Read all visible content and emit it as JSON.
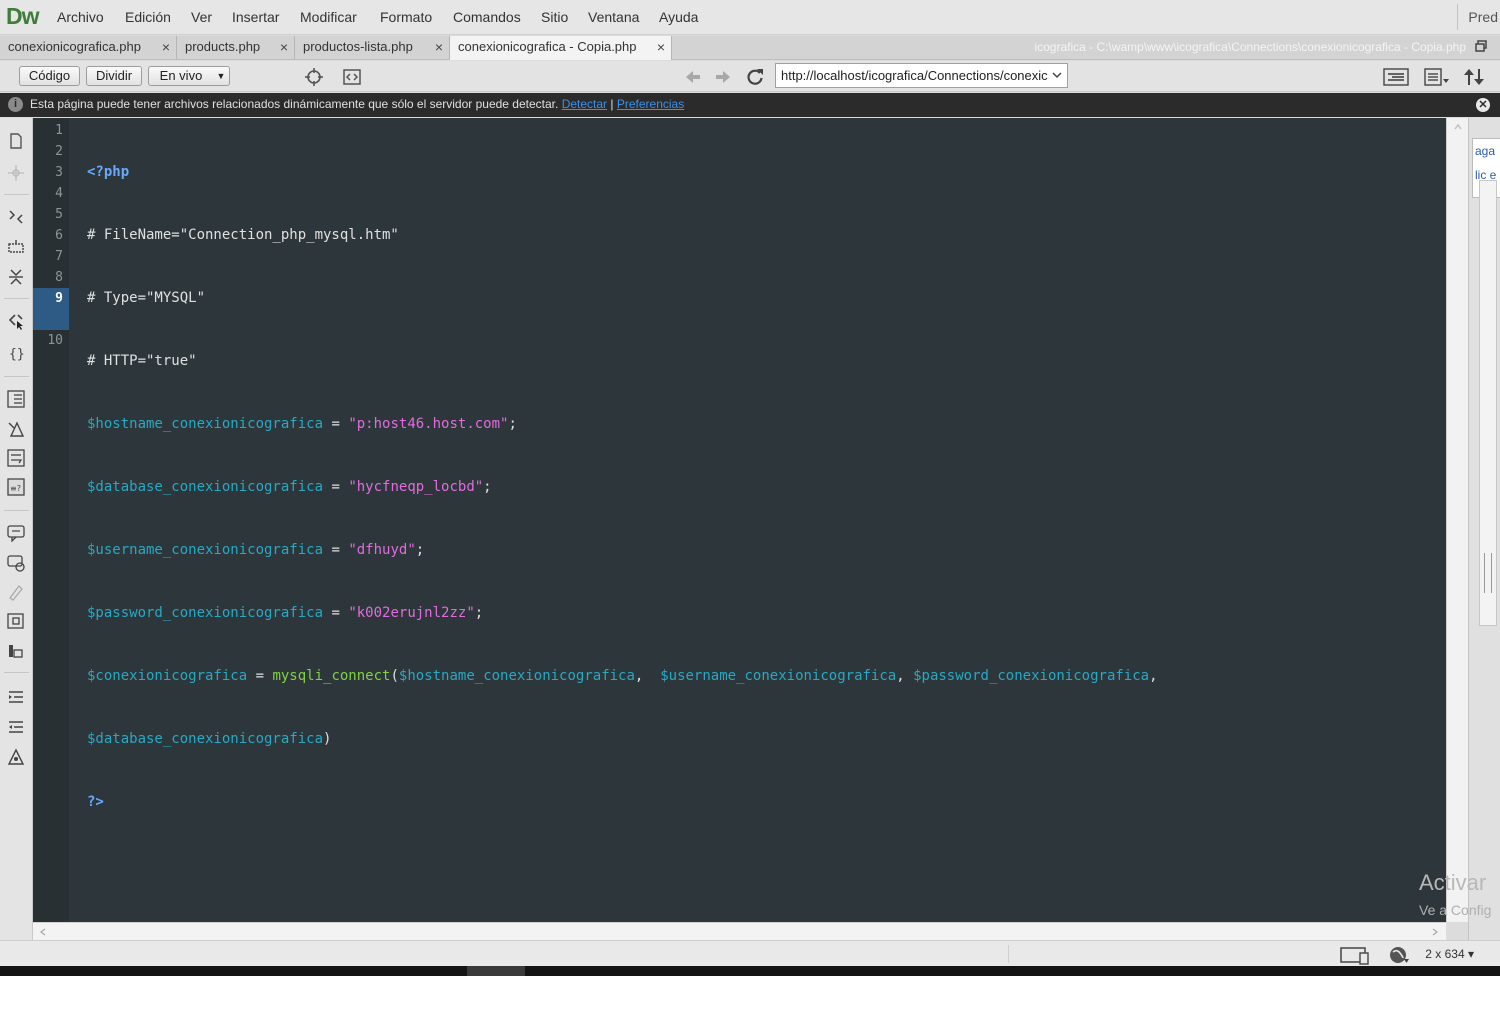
{
  "app": {
    "logo": "Dw",
    "menu": [
      "Archivo",
      "Edición",
      "Ver",
      "Insertar",
      "Modificar",
      "Formato",
      "Comandos",
      "Sitio",
      "Ventana",
      "Ayuda"
    ],
    "workspace_label": "Pred"
  },
  "tabs": [
    {
      "label": "conexionicografica.php",
      "close": "×"
    },
    {
      "label": "products.php",
      "close": "×"
    },
    {
      "label": "productos-lista.php",
      "close": "×"
    },
    {
      "label": "conexionicografica - Copia.php",
      "close": "×"
    }
  ],
  "filepath": "icografica - C:\\wamp\\www\\icografica\\Connections\\conexionicografica - Copia.php",
  "toolbar": {
    "code_label": "Código",
    "split_label": "Dividir",
    "live_label": "En vivo",
    "address": "http://localhost/icografica/Connections/conexic"
  },
  "infobar": {
    "message": "Esta página puede tener archivos relacionados dinámicamente que sólo el servidor puede detectar.",
    "detect_link": "Detectar",
    "separator": "|",
    "prefs_link": "Preferencias"
  },
  "editor": {
    "line_numbers": [
      "1",
      "2",
      "3",
      "4",
      "5",
      "6",
      "7",
      "8",
      "9",
      "",
      "10"
    ],
    "current_line": "9",
    "code": {
      "l1": "<?php",
      "l2": "# FileName=\"Connection_php_mysql.htm\"",
      "l3": "# Type=\"MYSQL\"",
      "l4": "# HTTP=\"true\"",
      "l5_var": "$hostname_conexionicografica",
      "l5_str": "\"p:host46.host.com\"",
      "l6_var": "$database_conexionicografica",
      "l6_str": "\"hycfneqp_locbd\"",
      "l7_var": "$username_conexionicografica",
      "l7_str": "\"dfhuyd\"",
      "l8_var": "$password_conexionicografica",
      "l8_str": "\"k002erujnl2zz\"",
      "l9_var": "$conexionicografica",
      "l9_fn": "mysqli_connect",
      "l9_arg1": "$hostname_conexionicografica",
      "l9_arg2": "$username_conexionicografica",
      "l9_arg3": "$password_conexionicografica",
      "l9b_arg4": "$database_conexionicografica",
      "l10": "?>",
      "assign": " = ",
      "semicolon": ";",
      "open_paren": "(",
      "close_paren": ")",
      "comma_space": ",  ",
      "comma": ", ",
      "trailing_comma": ","
    }
  },
  "right_panel": {
    "snippet": "aga\nlic e"
  },
  "watermark": {
    "title": "Activar",
    "subtitle": "Ve a Config"
  },
  "statusbar": {
    "size": "2 x 634 ▾"
  },
  "colors": {
    "editor_bg": "#2d363a",
    "variable": "#27a9c4",
    "string": "#e26bde",
    "function": "#7fd341",
    "php_tag": "#6aa8ff",
    "link": "#3f8fe8"
  }
}
